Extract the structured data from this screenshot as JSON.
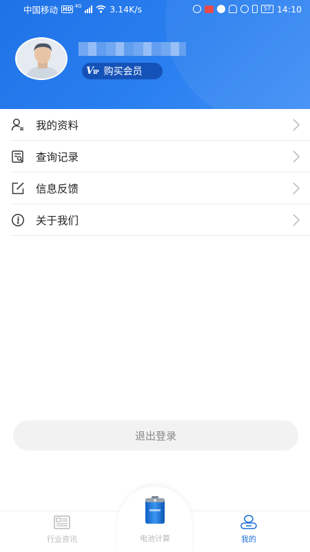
{
  "status_bar": {
    "carrier": "中国移动",
    "hd": "HD",
    "network": "4G",
    "speed": "3.14K/s",
    "battery": "57",
    "time": "14:10"
  },
  "profile": {
    "vip_icon": "V",
    "vip_icon_small": "IP",
    "vip_label": "购买会员"
  },
  "menu": {
    "items": [
      {
        "label": "我的资料",
        "icon": "user-profile-icon"
      },
      {
        "label": "查询记录",
        "icon": "search-record-icon"
      },
      {
        "label": "信息反馈",
        "icon": "feedback-edit-icon"
      },
      {
        "label": "关于我们",
        "icon": "info-icon"
      }
    ]
  },
  "logout_label": "退出登录",
  "tabbar": {
    "tabs": [
      {
        "label": "行业资讯",
        "icon": "news-icon",
        "active": false
      },
      {
        "label": "电池计算",
        "icon": "battery-icon",
        "active": false
      },
      {
        "label": "我的",
        "icon": "mine-icon",
        "active": true
      }
    ]
  },
  "colors": {
    "header_blue": "#1f72e6",
    "vip_badge": "#1552b8",
    "active_tab": "#1f6fd8",
    "inactive_tab": "#b9b9b9"
  }
}
